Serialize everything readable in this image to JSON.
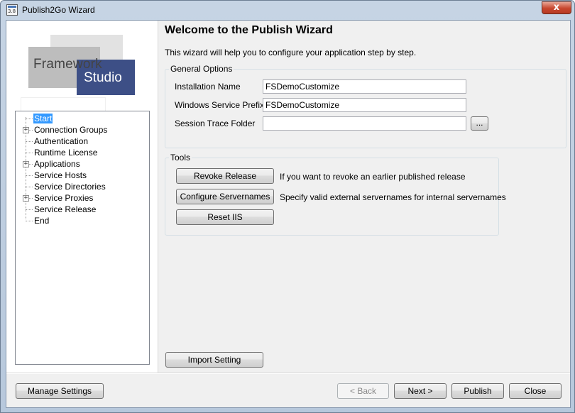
{
  "window": {
    "title": "Publish2Go Wizard",
    "icon_caption": "3.8",
    "close_glyph": "x"
  },
  "logo": {
    "line1": "Framework",
    "line2": "Studio"
  },
  "tree": {
    "items": [
      {
        "label": "Start",
        "selected": true,
        "expandable": false
      },
      {
        "label": "Connection Groups",
        "expandable": true
      },
      {
        "label": "Authentication",
        "expandable": false
      },
      {
        "label": "Runtime License",
        "expandable": false
      },
      {
        "label": "Applications",
        "expandable": true
      },
      {
        "label": "Service Hosts",
        "expandable": false
      },
      {
        "label": "Service Directories",
        "expandable": false
      },
      {
        "label": "Service Proxies",
        "expandable": true
      },
      {
        "label": "Service Release",
        "expandable": false
      },
      {
        "label": "End",
        "expandable": false
      }
    ],
    "expander_glyph": "+"
  },
  "main": {
    "heading": "Welcome to the Publish Wizard",
    "intro": "This wizard will help you to configure your application step by step.",
    "general_options": {
      "title": "General Options",
      "installation_name_label": "Installation Name",
      "installation_name_value": "FSDemoCustomize",
      "service_prefix_label": "Windows Service Prefix",
      "service_prefix_value": "FSDemoCustomize",
      "trace_folder_label": "Session Trace Folder",
      "trace_folder_value": "",
      "browse_label": "..."
    },
    "tools": {
      "title": "Tools",
      "revoke_label": "Revoke Release",
      "revoke_desc": "If you want to revoke an earlier published release",
      "configure_label": "Configure Servernames",
      "configure_desc": "Specify valid external servernames for internal servernames",
      "reset_label": "Reset IIS"
    },
    "import_label": "Import Setting"
  },
  "footer": {
    "manage_label": "Manage Settings",
    "back_label": "< Back",
    "next_label": "Next >",
    "publish_label": "Publish",
    "close_label": "Close"
  },
  "colors": {
    "selection": "#3399ff",
    "logo_blue": "#3d4f86",
    "window_frame": "#b7c8dc",
    "close_red": "#c7462e"
  }
}
